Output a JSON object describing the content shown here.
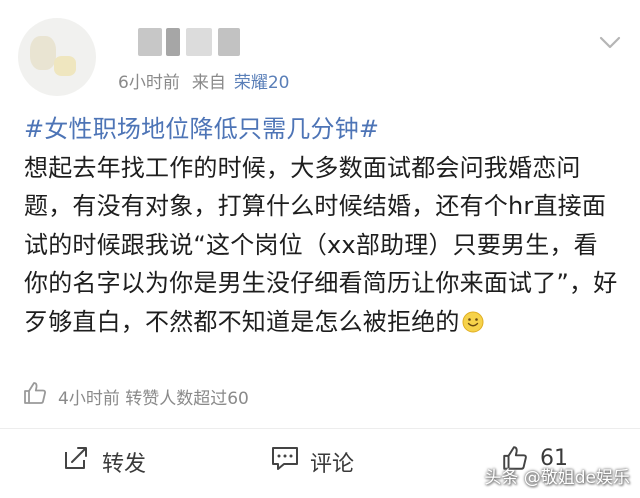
{
  "post": {
    "meta": {
      "time": "6小时前",
      "from_label": "来自",
      "device": "荣耀20"
    },
    "topic": "#女性职场地位降低只需几分钟#",
    "body": "想起去年找工作的时候，大多数面试都会问我婚恋问题，有没有对象，打算什么时候结婚，还有个hr直接面试的时候跟我说“这个岗位（xx部助理）只要男生，看你的名字以为你是男生没仔细看简历让你来面试了”，好歹够直白，不然都不知道是怎么被拒绝的",
    "emoji_icon": "smile-emoji-icon"
  },
  "like_info": {
    "text": "4小时前 转赞人数超过60"
  },
  "actions": {
    "share_label": "转发",
    "comment_label": "评论",
    "like_count": "61"
  },
  "watermark": {
    "text": "头条 @敬姐de娱乐"
  },
  "colors": {
    "topic": "#4d74b6",
    "device_link": "#5a7fb8",
    "meta_gray": "#8a8a8a",
    "text": "#1e1e1e"
  }
}
